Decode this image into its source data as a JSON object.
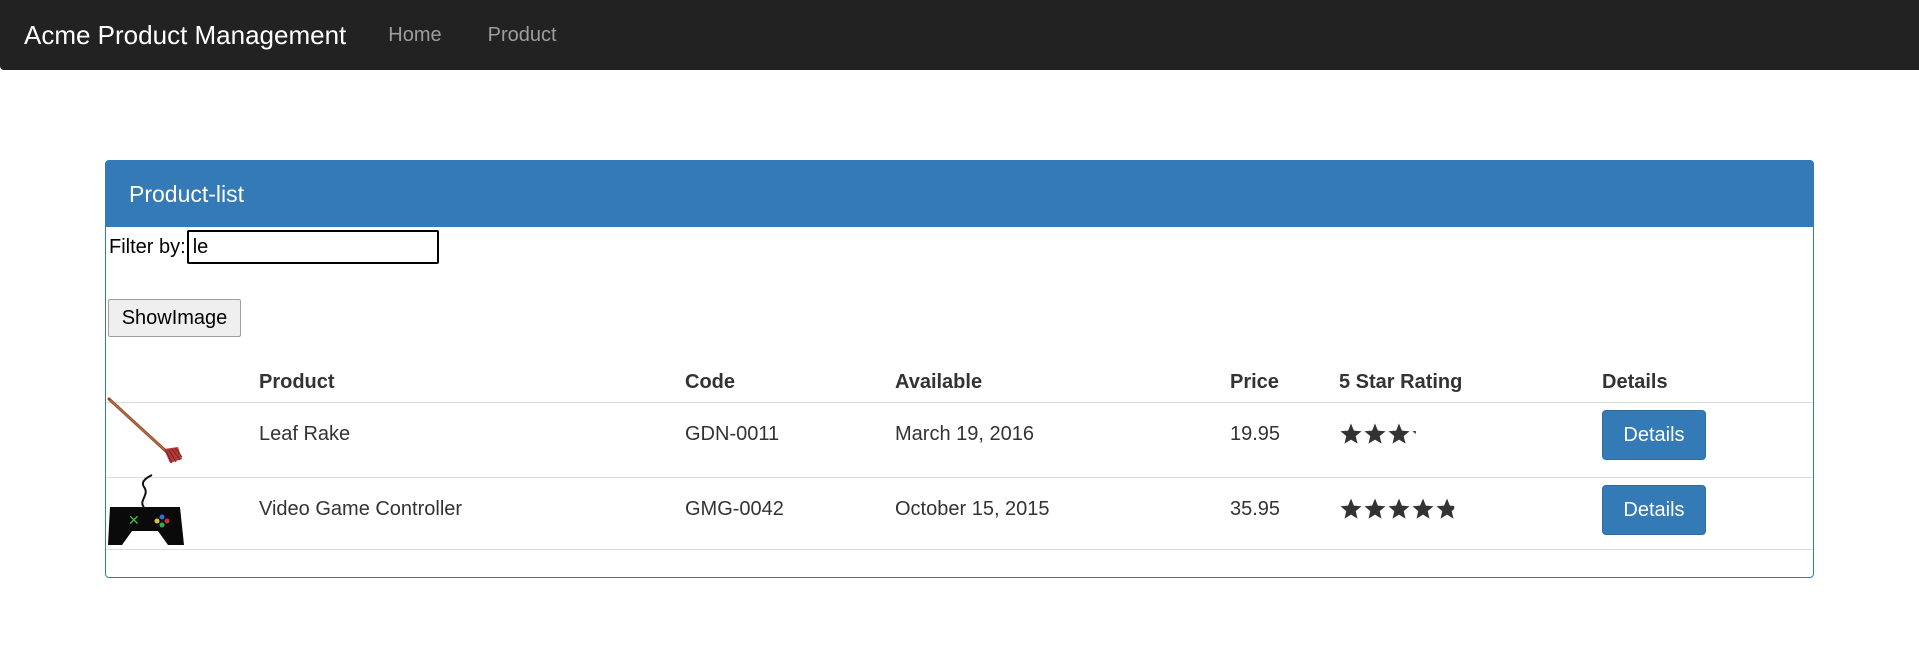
{
  "navbar": {
    "brand": "Acme Product Management",
    "links": [
      "Home",
      "Product"
    ]
  },
  "panel": {
    "title": "Product-list",
    "filter_label": "Filter by:",
    "filter_value": "le",
    "show_image_label": "ShowImage"
  },
  "table": {
    "columns": [
      "Product",
      "Code",
      "Available",
      "Price",
      "5 Star Rating",
      "Details"
    ],
    "rows": [
      {
        "image_icon": "leaf-rake-icon",
        "product": "Leaf Rake",
        "code": "GDN-0011",
        "available": "March 19, 2016",
        "price": "19.95",
        "rating": 3.2,
        "details_label": "Details"
      },
      {
        "image_icon": "game-controller-icon",
        "product": "Video Game Controller",
        "code": "GMG-0042",
        "available": "October 15, 2015",
        "price": "35.95",
        "rating": 4.8,
        "details_label": "Details"
      }
    ]
  },
  "colors": {
    "navbar_bg": "#222222",
    "primary": "#337ab7",
    "star": "#333333"
  }
}
